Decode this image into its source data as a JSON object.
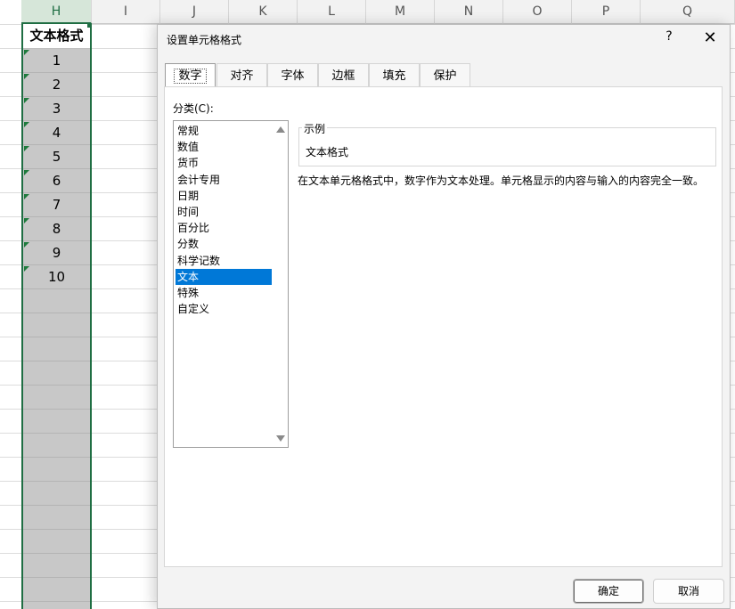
{
  "sheet": {
    "columns": [
      "H",
      "I",
      "J",
      "K",
      "L",
      "M",
      "N",
      "O",
      "P",
      "Q"
    ],
    "header_cell": "文本格式",
    "values": [
      "1",
      "2",
      "3",
      "4",
      "5",
      "6",
      "7",
      "8",
      "9",
      "10"
    ],
    "accent": "#1f6e43"
  },
  "dialog": {
    "title": "设置单元格格式",
    "help_glyph": "?",
    "close_glyph": "✕",
    "tabs": [
      {
        "label": "数字",
        "active": true
      },
      {
        "label": "对齐"
      },
      {
        "label": "字体"
      },
      {
        "label": "边框"
      },
      {
        "label": "填充"
      },
      {
        "label": "保护"
      }
    ],
    "category_label": "分类(C):",
    "categories": [
      "常规",
      "数值",
      "货币",
      "会计专用",
      "日期",
      "时间",
      "百分比",
      "分数",
      "科学记数",
      "文本",
      "特殊",
      "自定义"
    ],
    "selected_category": "文本",
    "sample_label": "示例",
    "sample_value": "文本格式",
    "description": "在文本单元格格式中，数字作为文本处理。单元格显示的内容与输入的内容完全一致。",
    "ok_label": "确定",
    "cancel_label": "取消",
    "selection_color": "#0078d7"
  }
}
